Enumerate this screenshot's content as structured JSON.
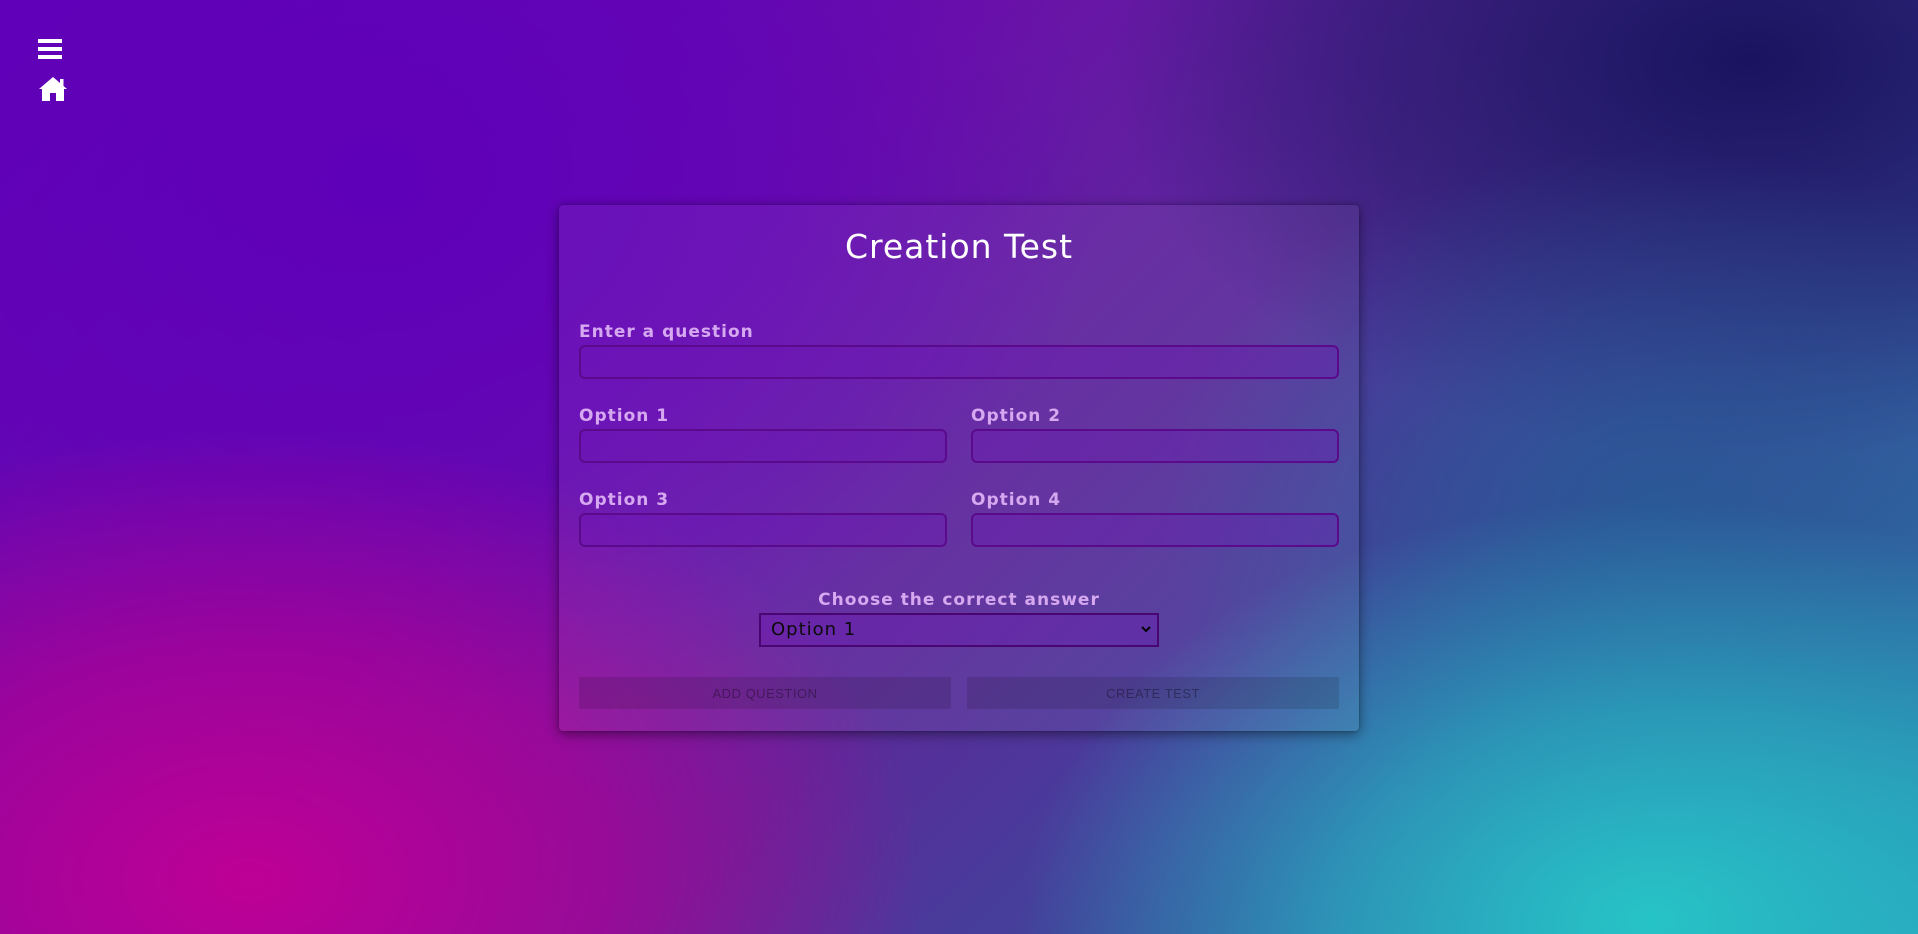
{
  "nav": {
    "menu_icon": "hamburger-menu-icon",
    "home_icon": "home-icon"
  },
  "form": {
    "title": "Creation Test",
    "question": {
      "label": "Enter a question",
      "value": ""
    },
    "options": [
      {
        "label": "Option 1",
        "value": ""
      },
      {
        "label": "Option 2",
        "value": ""
      },
      {
        "label": "Option 3",
        "value": ""
      },
      {
        "label": "Option 4",
        "value": ""
      }
    ],
    "correct_answer": {
      "label": "Choose the correct answer",
      "selected": "Option 1",
      "choices": [
        "Option 1",
        "Option 2",
        "Option 3",
        "Option 4"
      ]
    },
    "buttons": {
      "add_question": "ADD QUESTION",
      "create_test": "CREATE TEST"
    }
  },
  "colors": {
    "label": "#d6a8f0",
    "input_border": "#5a0a8a",
    "title": "#ffffff"
  }
}
